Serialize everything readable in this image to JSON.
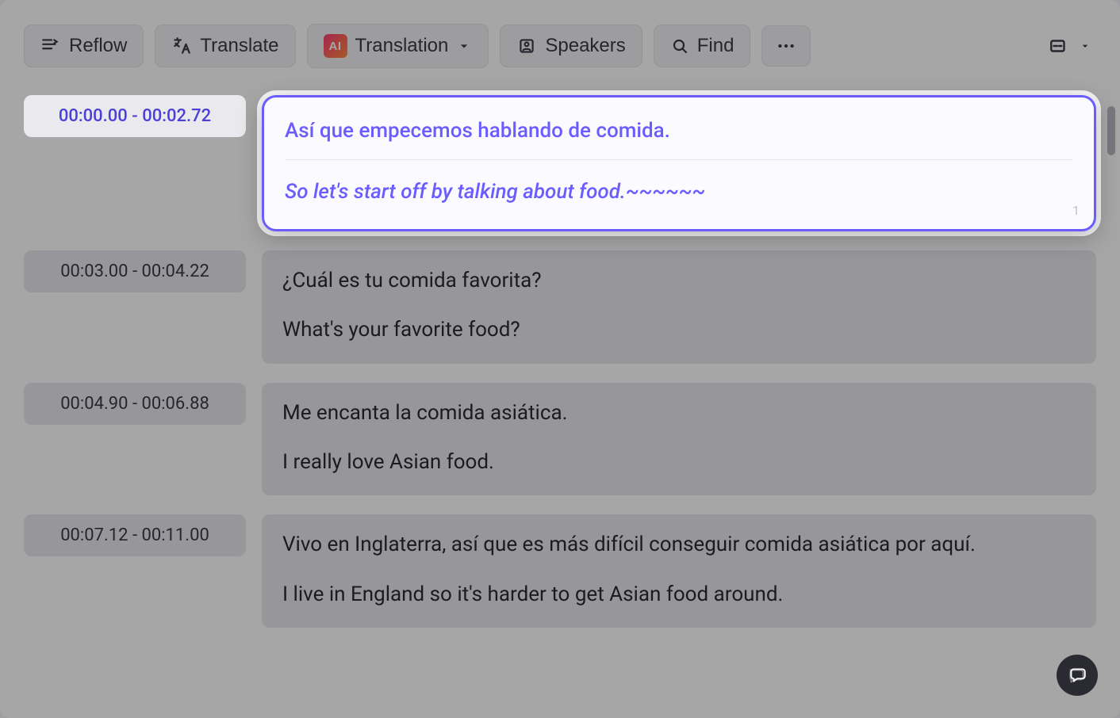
{
  "toolbar": {
    "reflow_label": "Reflow",
    "translate_label": "Translate",
    "translation_dropdown_label": "Translation",
    "speakers_label": "Speakers",
    "find_label": "Find",
    "ai_badge": "AI"
  },
  "segments": [
    {
      "time": "00:00.00 - 00:02.72",
      "source": "Así que empecemos hablando de comida.",
      "translation": "So let's start off by talking about food.~~~~~~",
      "index": "1"
    },
    {
      "time": "00:03.00 - 00:04.22",
      "source": "¿Cuál es tu comida favorita?",
      "translation": "What's your favorite food?"
    },
    {
      "time": "00:04.90 - 00:06.88",
      "source": "Me encanta la comida asiática.",
      "translation": "I really love Asian food."
    },
    {
      "time": "00:07.12  -  00:11.00",
      "source": "Vivo en Inglaterra, así que es más difícil conseguir comida asiática por aquí.",
      "translation": "I live in England so it's harder to get Asian food around."
    }
  ],
  "colors": {
    "accent": "#6a5cff",
    "chip_bg": "#e9e9ee",
    "text": "#2a2a33"
  }
}
